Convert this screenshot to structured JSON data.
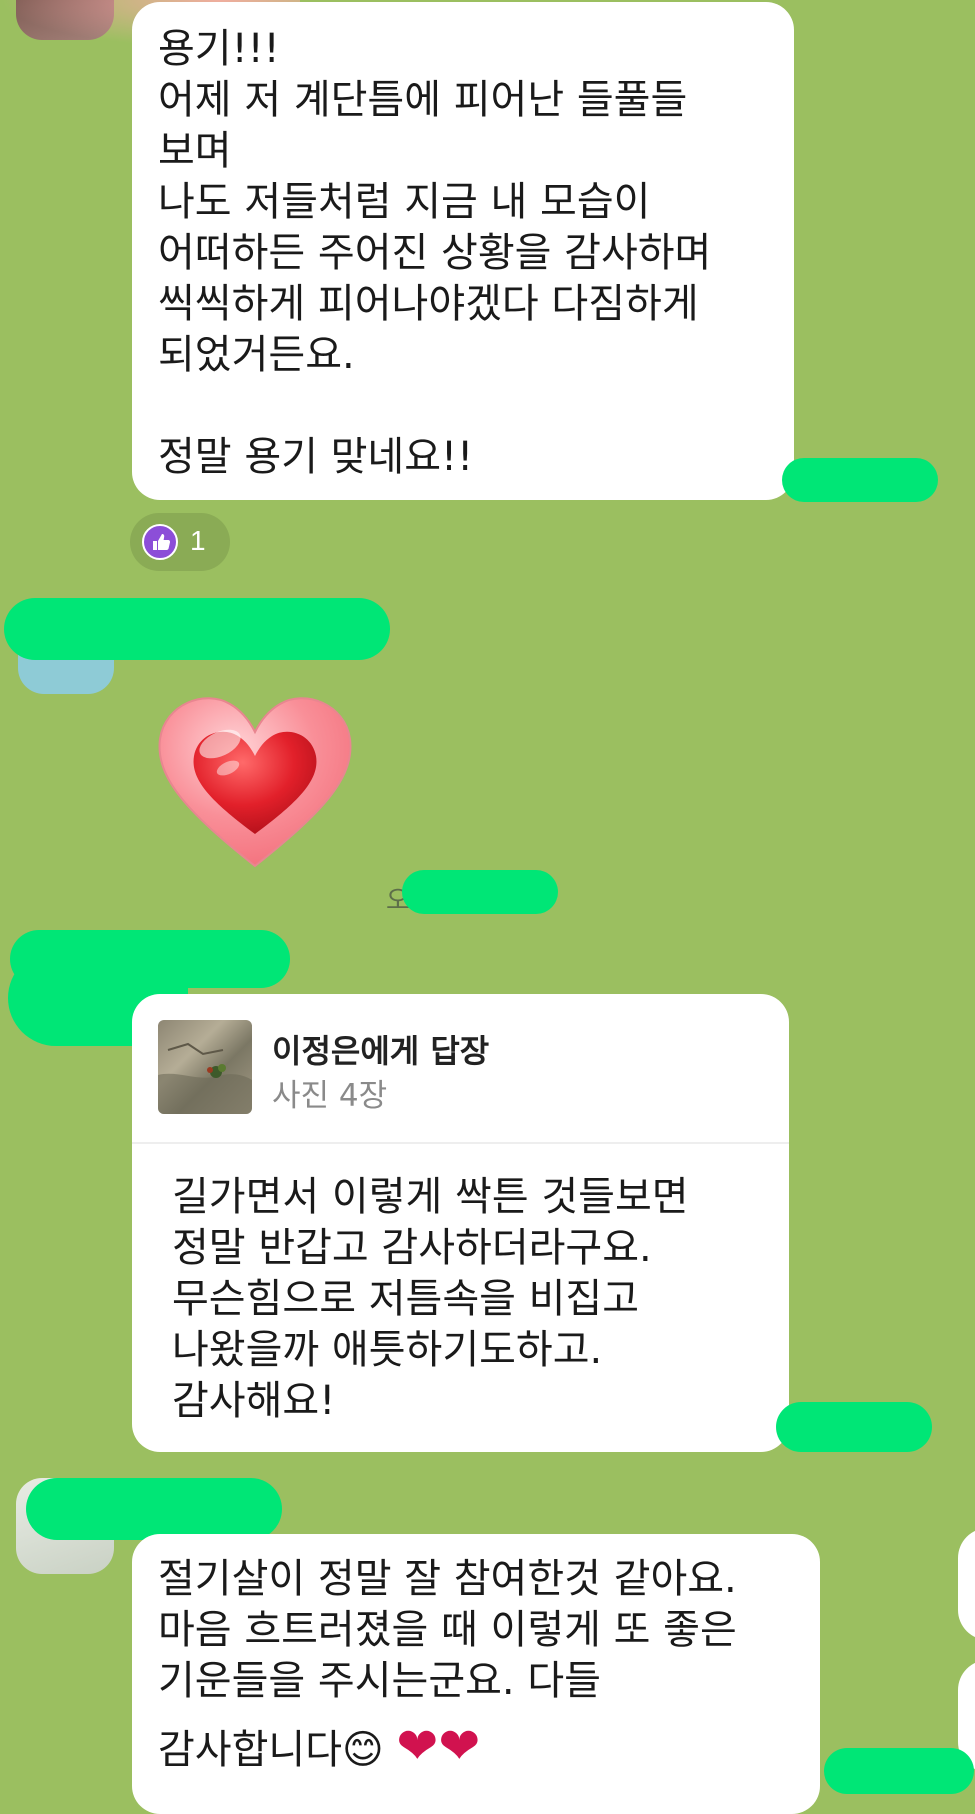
{
  "message1": {
    "lines": [
      "용기!!!",
      "어제 저 계단틈에 피어난 들풀들",
      "보며",
      "나도 저들처럼 지금 내 모습이",
      "어떠하든 주어진 상황을 감사하며",
      "씩씩하게 피어나야겠다 다짐하게",
      "되었거든요.",
      "",
      "정말 용기 맞네요!!"
    ],
    "reaction": {
      "icon": "thumbs-up-icon",
      "count": "1"
    }
  },
  "message2": {
    "sticker": "heart-sticker"
  },
  "message3": {
    "reply": {
      "title": "이정은에게 답장",
      "subtitle": "사진 4장"
    },
    "lines": [
      "길가면서 이렇게 싹튼 것들보면",
      "정말 반갑고 감사하더라구요.",
      "무슨힘으로 저틈속을 비집고",
      "나왔을까 애틋하기도하고.",
      "감사해요!"
    ]
  },
  "message4": {
    "lines": [
      "절기살이 정말 잘 참여한것 같아요.",
      "마음 흐트러졌을 때 이렇게 또 좋은",
      "기운들을 주시는군요. 다들"
    ],
    "last_line": "감사합니다😊 ",
    "emoji": "❤❤"
  },
  "colors": {
    "background": "#9bbf60",
    "bubble": "#ffffff",
    "redaction": "#00e676",
    "reaction_accent": "#8c4ed8"
  }
}
